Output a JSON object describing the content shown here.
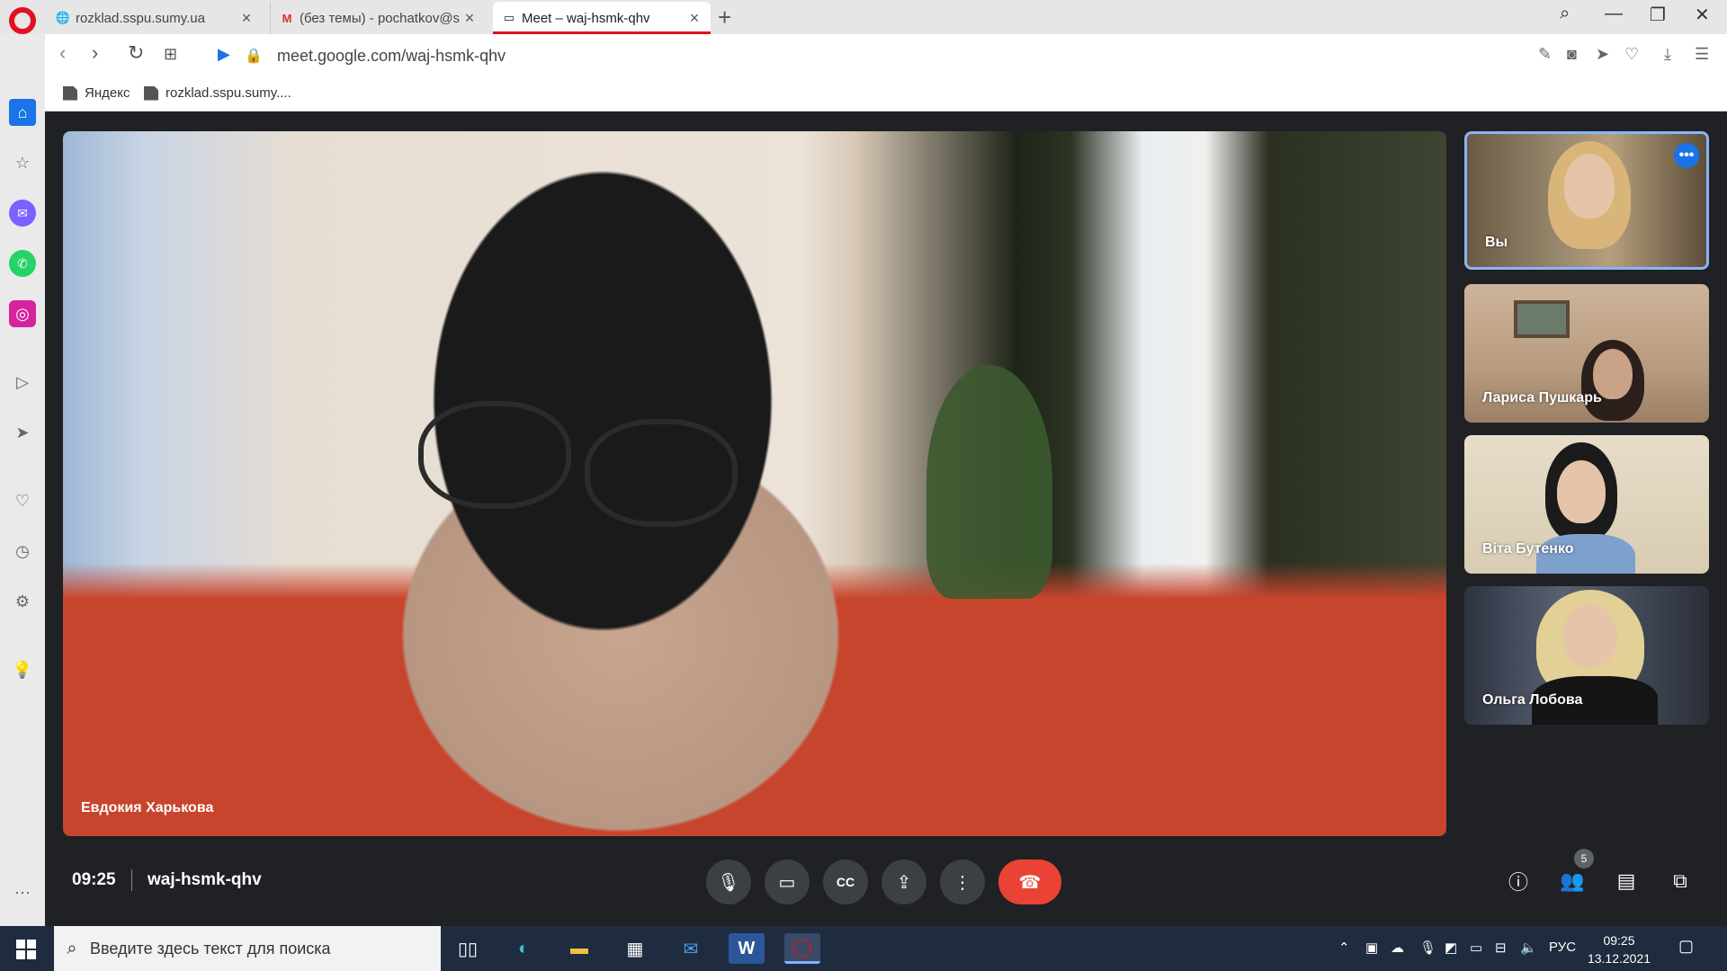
{
  "browser": {
    "tabs": [
      {
        "title": "rozklad.sspu.sumy.ua",
        "favicon": "globe-icon"
      },
      {
        "title": "(без темы) - pochatkov@s",
        "favicon": "gmail-icon"
      },
      {
        "title": "Meet – waj-hsmk-qhv",
        "favicon": "meet-icon",
        "active": true
      }
    ],
    "url": "meet.google.com/waj-hsmk-qhv",
    "bookmarks": [
      {
        "label": "Яндекс"
      },
      {
        "label": "rozklad.sspu.sumy...."
      }
    ]
  },
  "meet": {
    "main_speaker": "Евдокия Харькова",
    "participants": [
      {
        "name": "Вы",
        "self": true
      },
      {
        "name": "Лариса Пушкарь"
      },
      {
        "name": "Віта Бутенко"
      },
      {
        "name": "Ольга Лобова"
      }
    ],
    "time": "09:25",
    "meeting_code": "waj-hsmk-qhv",
    "participant_count": "5"
  },
  "taskbar": {
    "search_placeholder": "Введите здесь текст для поиска",
    "language": "РУС",
    "clock_time": "09:25",
    "clock_date": "13.12.2021"
  },
  "colors": {
    "accent": "#1a73e8",
    "leave": "#ea4335",
    "opera_red": "#e3101e",
    "meet_bg": "#202124"
  }
}
